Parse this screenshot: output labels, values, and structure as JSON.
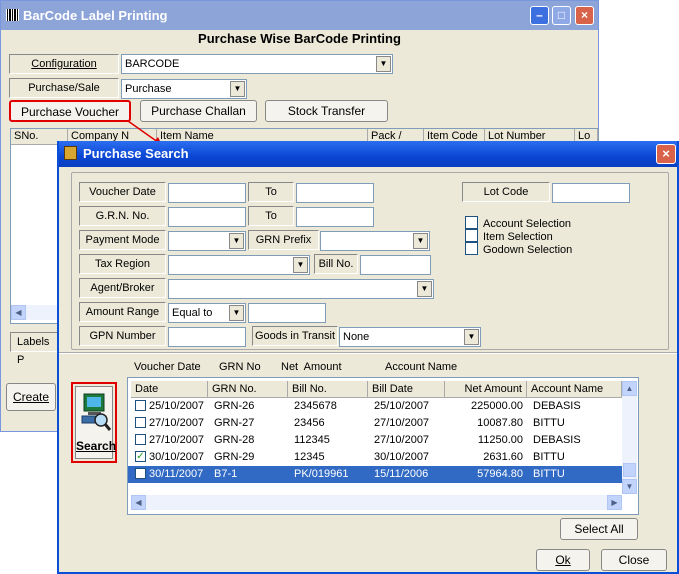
{
  "back_window": {
    "title": "BarCode Label Printing",
    "heading": "Purchase Wise BarCode Printing",
    "configuration_label": "Configuration",
    "configuration_value": "BARCODE",
    "purchase_sale_label": "Purchase/Sale",
    "purchase_sale_value": "Purchase",
    "buttons": {
      "purchase_voucher": "Purchase Voucher",
      "purchase_challan": "Purchase Challan",
      "stock_transfer": "Stock Transfer",
      "create": "Create"
    },
    "grid_headers": [
      "SNo.",
      "Company N",
      "Item Name",
      "Pack /",
      "Item Code",
      "Lot Number",
      "Lo"
    ],
    "labels_label": "Labels P"
  },
  "dialog": {
    "title": "Purchase Search",
    "filters": {
      "voucher_date": "Voucher Date",
      "to1": "To",
      "grn_no": "G.R.N. No.",
      "to2": "To",
      "payment_mode": "Payment Mode",
      "grn_prefix": "GRN Prefix",
      "tax_region": "Tax Region",
      "bill_no": "Bill No.",
      "agent_broker": "Agent/Broker",
      "amount_range": "Amount Range",
      "amount_range_value": "Equal to",
      "gpn_number": "GPN Number",
      "goods_in_transit": "Goods in Transit",
      "goods_in_transit_value": "None",
      "lot_code": "Lot Code"
    },
    "checkboxes": {
      "account_selection": "Account Selection",
      "item_selection": "Item Selection",
      "godown_selection": "Godown Selection"
    },
    "search_label": "Search",
    "column_titles": [
      "Voucher Date",
      "GRN No",
      "Net  Amount",
      "Account Name"
    ],
    "grid_headers": [
      "Date",
      "GRN No.",
      "Bill No.",
      "Bill Date",
      "Net Amount",
      "Account Name"
    ],
    "rows": [
      {
        "date": "25/10/2007",
        "grn": "GRN-26",
        "bill": "2345678",
        "bill_date": "25/10/2007",
        "amount": "225000.00",
        "account": "DEBASIS",
        "checked": false
      },
      {
        "date": "27/10/2007",
        "grn": "GRN-27",
        "bill": "23456",
        "bill_date": "27/10/2007",
        "amount": "10087.80",
        "account": "BITTU",
        "checked": false
      },
      {
        "date": "27/10/2007",
        "grn": "GRN-28",
        "bill": "112345",
        "bill_date": "27/10/2007",
        "amount": "11250.00",
        "account": "DEBASIS",
        "checked": false
      },
      {
        "date": "30/10/2007",
        "grn": "GRN-29",
        "bill": "12345",
        "bill_date": "30/10/2007",
        "amount": "2631.60",
        "account": "BITTU",
        "checked": true
      },
      {
        "date": "30/11/2007",
        "grn": "B7-1",
        "bill": "PK/019961",
        "bill_date": "15/11/2006",
        "amount": "57964.80",
        "account": "BITTU",
        "checked": false
      }
    ],
    "check_mark": "✓",
    "buttons": {
      "select_all": "Select All",
      "ok": "Ok",
      "close": "Close"
    }
  }
}
